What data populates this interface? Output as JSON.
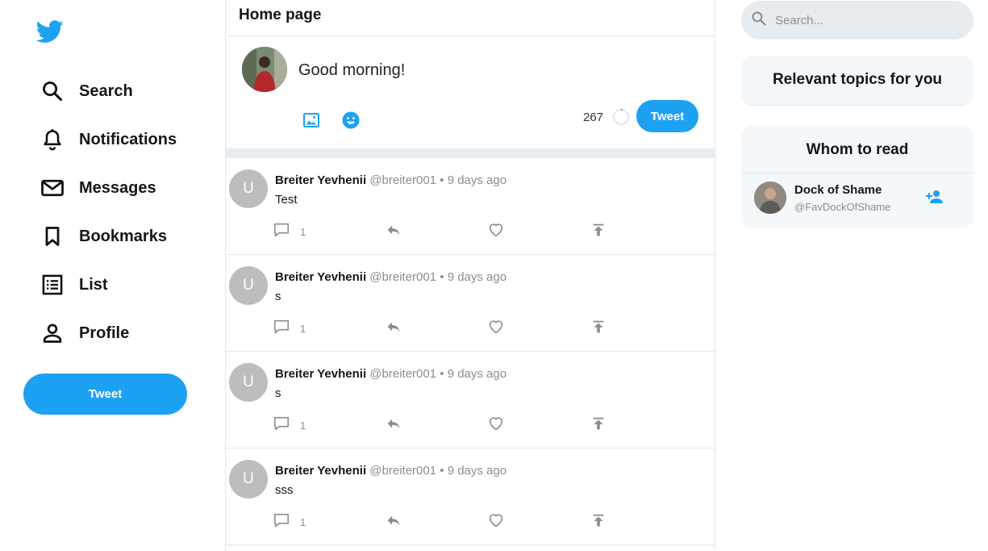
{
  "sidebar": {
    "logo_icon": "twitter-bird-icon",
    "items": [
      {
        "label": "Search",
        "icon": "search-icon"
      },
      {
        "label": "Notifications",
        "icon": "bell-icon"
      },
      {
        "label": "Messages",
        "icon": "mail-icon"
      },
      {
        "label": "Bookmarks",
        "icon": "bookmark-icon"
      },
      {
        "label": "List",
        "icon": "list-icon"
      },
      {
        "label": "Profile",
        "icon": "person-icon"
      }
    ],
    "tweet_button": "Tweet"
  },
  "main": {
    "title": "Home page",
    "composer": {
      "text": "Good morning!",
      "chars_left": "267",
      "tweet_button": "Tweet"
    },
    "tweets": [
      {
        "avatar_letter": "U",
        "name": "Breiter Yevhenii",
        "handle": "@breiter001",
        "separator": "•",
        "time": "9 days ago",
        "body": "Test",
        "reply_count": "1"
      },
      {
        "avatar_letter": "U",
        "name": "Breiter Yevhenii",
        "handle": "@breiter001",
        "separator": "•",
        "time": "9 days ago",
        "body": "s",
        "reply_count": "1"
      },
      {
        "avatar_letter": "U",
        "name": "Breiter Yevhenii",
        "handle": "@breiter001",
        "separator": "•",
        "time": "9 days ago",
        "body": "s",
        "reply_count": "1"
      },
      {
        "avatar_letter": "U",
        "name": "Breiter Yevhenii",
        "handle": "@breiter001",
        "separator": "•",
        "time": "9 days ago",
        "body": "sss",
        "reply_count": "1"
      }
    ]
  },
  "right": {
    "search_placeholder": "Search...",
    "topics_title": "Relevant topics for you",
    "whom_title": "Whom to read",
    "suggestions": [
      {
        "name": "Dock of Shame",
        "handle": "@FavDockOfShame"
      }
    ]
  },
  "colors": {
    "accent": "#1da1f2",
    "muted": "#8a8d91",
    "panel_bg": "#f5f8fa"
  }
}
